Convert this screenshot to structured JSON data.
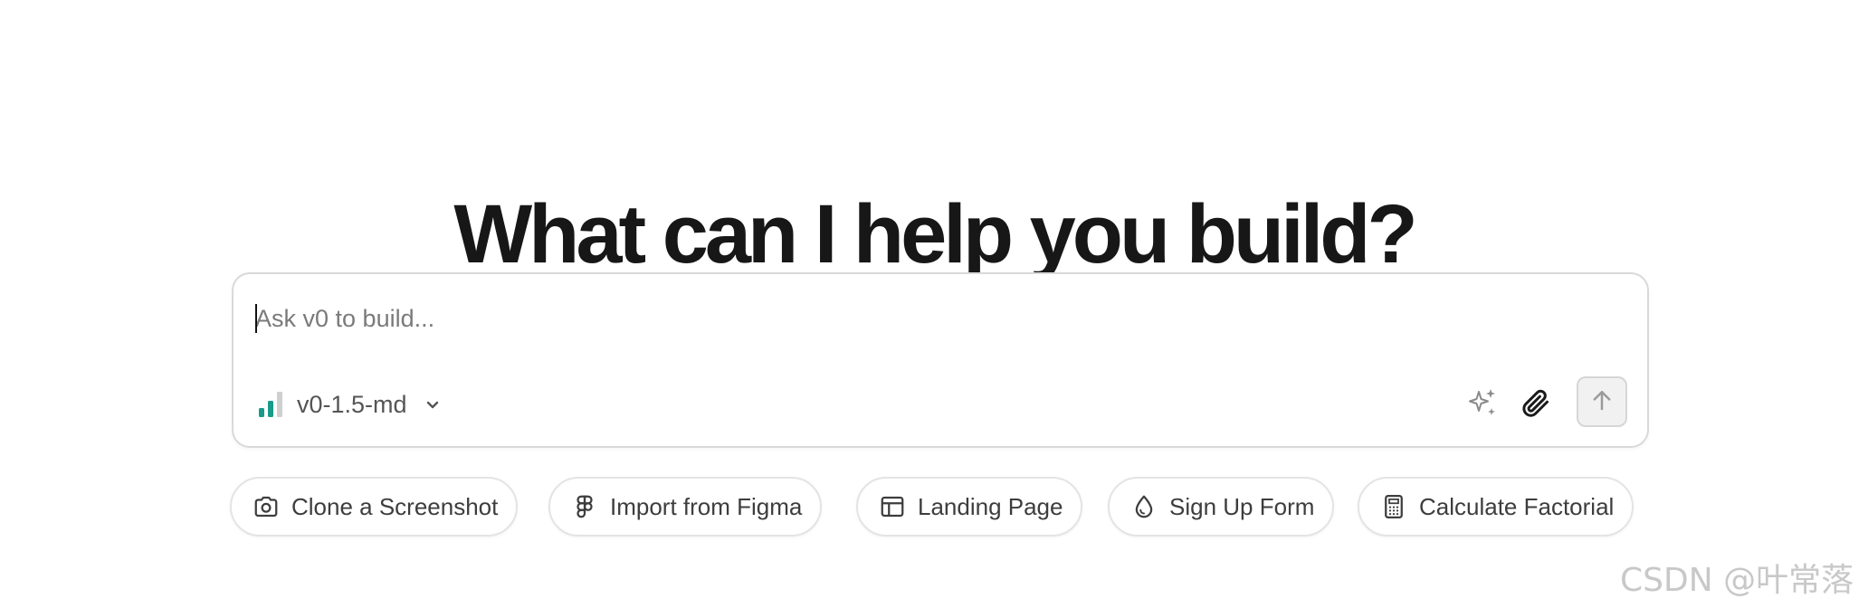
{
  "headline": "What can I help you build?",
  "prompt": {
    "placeholder": "Ask v0 to build...",
    "value": "",
    "model": {
      "label": "v0-1.5-md",
      "icon": "signal-bars-icon"
    },
    "tools": [
      {
        "name": "enhance-prompt",
        "icon": "sparkles-icon"
      },
      {
        "name": "attach",
        "icon": "paperclip-icon"
      }
    ],
    "send": {
      "icon": "arrow-up-icon",
      "enabled": false
    }
  },
  "suggestions": [
    {
      "label": "Clone a Screenshot",
      "icon": "camera-icon"
    },
    {
      "label": "Import from Figma",
      "icon": "figma-icon"
    },
    {
      "label": "Landing Page",
      "icon": "layout-icon"
    },
    {
      "label": "Sign Up Form",
      "icon": "droplet-icon"
    },
    {
      "label": "Calculate Factorial",
      "icon": "calculator-icon"
    }
  ],
  "watermark": "CSDN @叶常落",
  "colors": {
    "accent": "#1a9a8a",
    "text": "#171717",
    "muted": "#7a7a7a",
    "border": "#d9d9d9"
  }
}
